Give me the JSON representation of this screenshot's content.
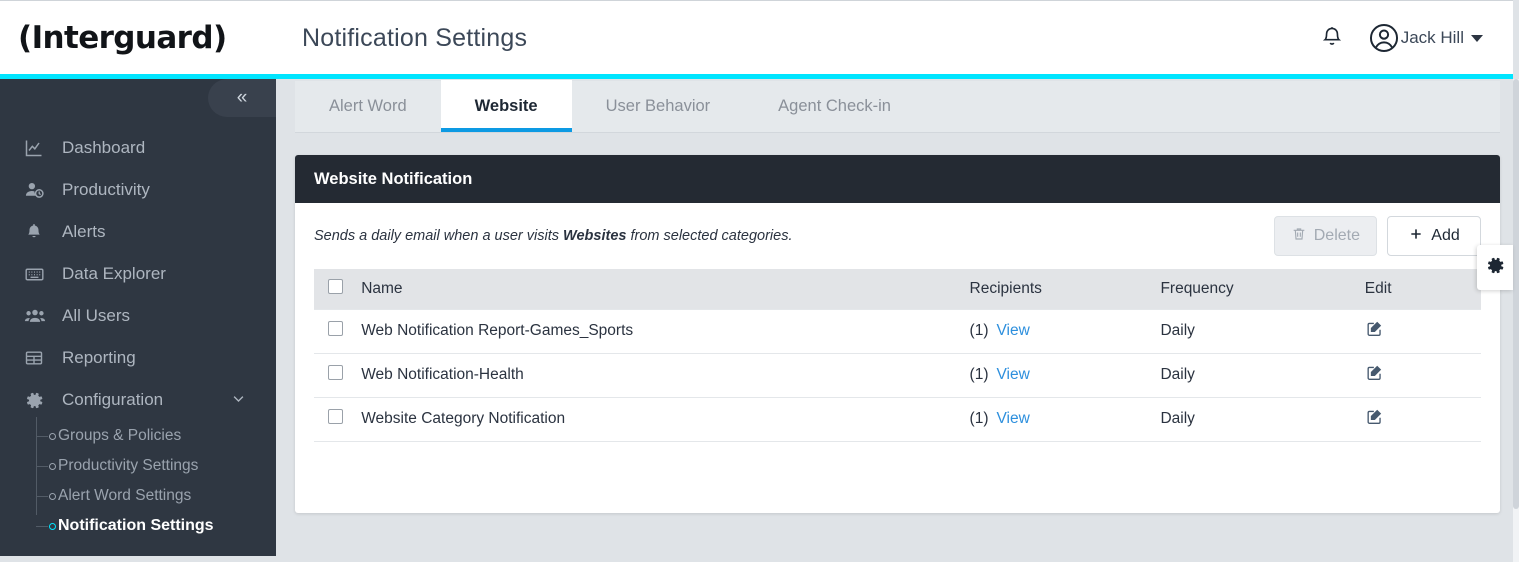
{
  "brand": {
    "logo_text": "(Interguard)",
    "accent_color": "#00e5ff"
  },
  "header": {
    "title": "Notification Settings",
    "bell_icon": "bell-icon",
    "avatar_icon": "user-circle-icon",
    "user_name": "Jack Hill"
  },
  "sidebar": {
    "collapse_label": "«",
    "items": [
      {
        "label": "Dashboard",
        "icon": "chart-line-icon"
      },
      {
        "label": "Productivity",
        "icon": "user-clock-icon"
      },
      {
        "label": "Alerts",
        "icon": "bell-icon"
      },
      {
        "label": "Data Explorer",
        "icon": "keyboard-grid-icon"
      },
      {
        "label": "All Users",
        "icon": "users-icon"
      },
      {
        "label": "Reporting",
        "icon": "table-icon"
      },
      {
        "label": "Configuration",
        "icon": "gear-icon",
        "expanded": true,
        "chevron": "⌄"
      }
    ],
    "sub_items": [
      {
        "label": "Groups & Policies",
        "active": false
      },
      {
        "label": "Productivity Settings",
        "active": false
      },
      {
        "label": "Alert Word Settings",
        "active": false
      },
      {
        "label": "Notification Settings",
        "active": true
      }
    ]
  },
  "tabs": [
    {
      "label": "Alert Word",
      "active": false
    },
    {
      "label": "Website",
      "active": true
    },
    {
      "label": "User Behavior",
      "active": false
    },
    {
      "label": "Agent Check-in",
      "active": false
    }
  ],
  "card": {
    "title": "Website Notification",
    "description_before": "Sends a daily email when a user visits ",
    "description_bold": "Websites",
    "description_after": " from selected categories.",
    "delete_label": "Delete",
    "delete_icon": "trash-icon",
    "delete_disabled": true,
    "add_label": "Add",
    "add_icon": "plus-icon"
  },
  "table": {
    "columns": [
      "",
      "Name",
      "Recipients",
      "Frequency",
      "Edit"
    ],
    "rows": [
      {
        "name": "Web Notification Report-Games_Sports",
        "recipients_count": "(1)",
        "recipients_link": "View",
        "frequency": "Daily",
        "edit_icon": "edit-pencil-icon",
        "checked": false
      },
      {
        "name": "Web Notification-Health",
        "recipients_count": "(1)",
        "recipients_link": "View",
        "frequency": "Daily",
        "edit_icon": "edit-pencil-icon",
        "checked": false
      },
      {
        "name": "Website Category Notification",
        "recipients_count": "(1)",
        "recipients_link": "View",
        "frequency": "Daily",
        "edit_icon": "edit-pencil-icon",
        "checked": false
      }
    ]
  },
  "side_panel": {
    "gear_icon": "gear-icon"
  }
}
